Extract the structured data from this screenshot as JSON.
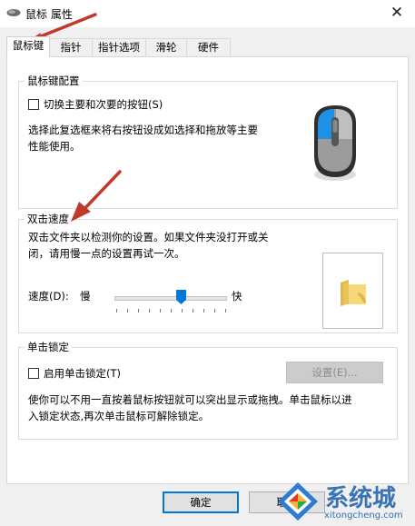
{
  "window": {
    "title": "鼠标 属性",
    "close_glyph": "✕"
  },
  "tabs": [
    {
      "label": "鼠标键"
    },
    {
      "label": "指针"
    },
    {
      "label": "指针选项"
    },
    {
      "label": "滑轮"
    },
    {
      "label": "硬件"
    }
  ],
  "button_config": {
    "title": "鼠标键配置",
    "checkbox_label": "切换主要和次要的按钮(S)",
    "checked": false,
    "description_line1": "选择此复选框来将右按钮设成如选择和拖放等主要",
    "description_line2": "性能使用。"
  },
  "double_click": {
    "title": "双击速度",
    "description_line1": "双击文件夹以检测你的设置。如果文件夹没打开或关",
    "description_line2": "闭，请用慢一点的设置再试一次。",
    "speed_label": "速度(D):",
    "slow_label": "慢",
    "fast_label": "快",
    "speed_value_fraction": 0.6
  },
  "click_lock": {
    "title": "单击锁定",
    "checkbox_label": "启用单击锁定(T)",
    "checked": false,
    "settings_button": "设置(E)...",
    "description_line1": "使你可以不用一直按着鼠标按钮就可以突出显示或拖拽。单击鼠标以进",
    "description_line2": "入锁定状态,再次单击鼠标可解除锁定。"
  },
  "footer": {
    "ok_label": "确定",
    "cancel_label": "取消"
  },
  "watermark": {
    "name": "系统城",
    "url": "xitongcheng.com"
  },
  "colors": {
    "accent": "#0078d7",
    "annotation_arrow": "#c0392b"
  }
}
